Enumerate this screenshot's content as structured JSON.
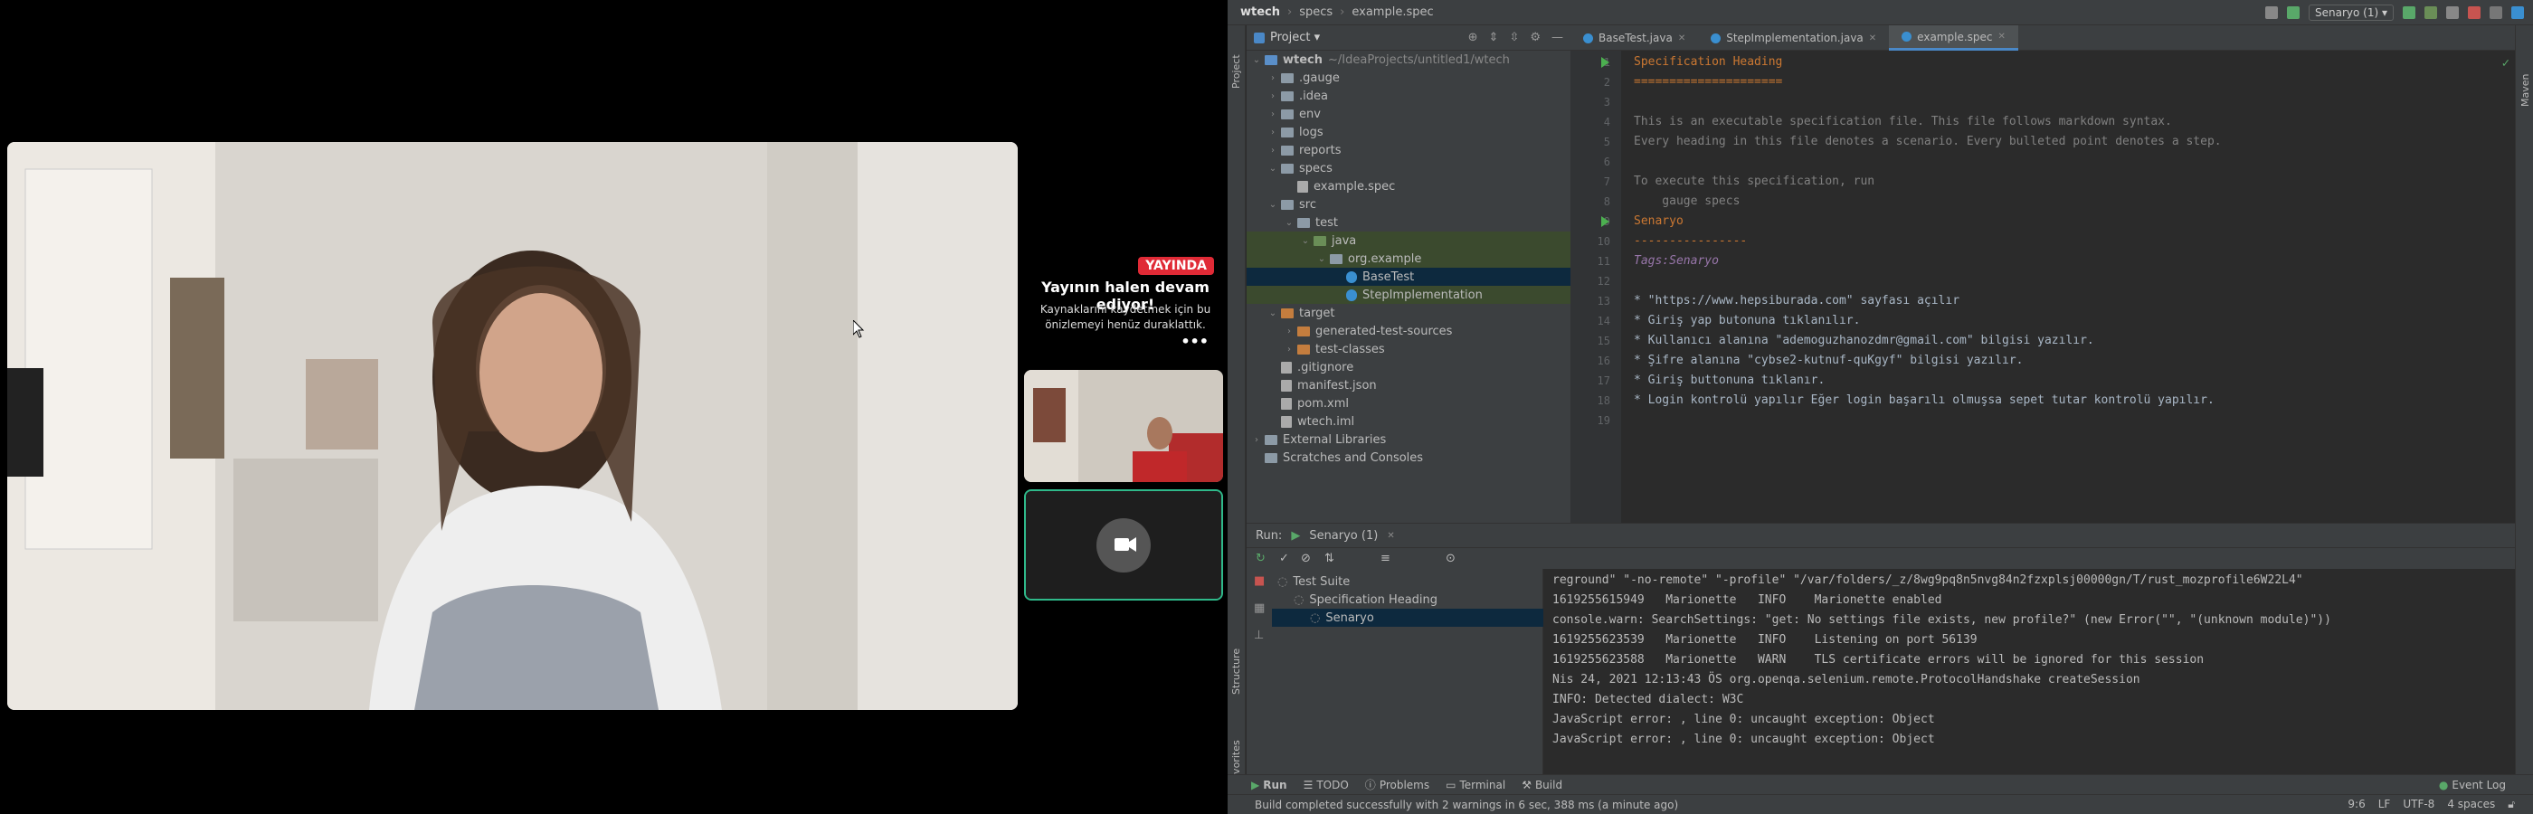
{
  "call": {
    "live_badge": "YAYINDA",
    "live_title": "Yayının halen devam ediyor!",
    "live_desc": "Kaynaklarını kaydetmek için bu önizlemeyi henüz duraklattık.",
    "more": "•••"
  },
  "ide": {
    "breadcrumb": [
      "wtech",
      "specs",
      "example.spec"
    ],
    "run_config": "Senaryo (1) ▾",
    "project_label": "Project ▾",
    "tool_strip": {
      "project": "Project",
      "structure": "Structure",
      "favorites": "Favorites",
      "maven": "Maven"
    },
    "tree": [
      {
        "name": "wtech",
        "note": "~/IdeaProjects/untitled1/wtech",
        "indent": 0,
        "twist": "v",
        "icon": "fld b",
        "bold": true
      },
      {
        "name": ".gauge",
        "indent": 1,
        "twist": ">",
        "icon": "fld"
      },
      {
        "name": ".idea",
        "indent": 1,
        "twist": ">",
        "icon": "fld"
      },
      {
        "name": "env",
        "indent": 1,
        "twist": ">",
        "icon": "fld"
      },
      {
        "name": "logs",
        "indent": 1,
        "twist": ">",
        "icon": "fld"
      },
      {
        "name": "reports",
        "indent": 1,
        "twist": ">",
        "icon": "fld"
      },
      {
        "name": "specs",
        "indent": 1,
        "twist": "v",
        "icon": "fld"
      },
      {
        "name": "example.spec",
        "indent": 2,
        "twist": "",
        "icon": "fi doc"
      },
      {
        "name": "src",
        "indent": 1,
        "twist": "v",
        "icon": "fld"
      },
      {
        "name": "test",
        "indent": 2,
        "twist": "v",
        "icon": "fld"
      },
      {
        "name": "java",
        "indent": 3,
        "twist": "v",
        "icon": "fld g",
        "hl": true
      },
      {
        "name": "org.example",
        "indent": 4,
        "twist": "v",
        "icon": "fld",
        "hl": true
      },
      {
        "name": "BaseTest",
        "indent": 5,
        "twist": "",
        "icon": "fi",
        "sel": true
      },
      {
        "name": "StepImplementation",
        "indent": 5,
        "twist": "",
        "icon": "fi",
        "hl": true
      },
      {
        "name": "target",
        "indent": 1,
        "twist": "v",
        "icon": "fld o"
      },
      {
        "name": "generated-test-sources",
        "indent": 2,
        "twist": ">",
        "icon": "fld o"
      },
      {
        "name": "test-classes",
        "indent": 2,
        "twist": ">",
        "icon": "fld o"
      },
      {
        "name": ".gitignore",
        "indent": 1,
        "twist": "",
        "icon": "fi doc"
      },
      {
        "name": "manifest.json",
        "indent": 1,
        "twist": "",
        "icon": "fi doc"
      },
      {
        "name": "pom.xml",
        "indent": 1,
        "twist": "",
        "icon": "fi doc"
      },
      {
        "name": "wtech.iml",
        "indent": 1,
        "twist": "",
        "icon": "fi doc"
      },
      {
        "name": "External Libraries",
        "indent": 0,
        "twist": ">",
        "icon": "fld"
      },
      {
        "name": "Scratches and Consoles",
        "indent": 0,
        "twist": "",
        "icon": "fld"
      }
    ],
    "tabs": [
      {
        "label": "BaseTest.java",
        "active": false
      },
      {
        "label": "StepImplementation.java",
        "active": false
      },
      {
        "label": "example.spec",
        "active": true
      }
    ],
    "code_lines": [
      {
        "n": "1",
        "t": "Specification Heading",
        "c": "hd",
        "run": true
      },
      {
        "n": "2",
        "t": "=====================",
        "c": "hd"
      },
      {
        "n": "3",
        "t": "",
        "c": ""
      },
      {
        "n": "4",
        "t": "This is an executable specification file. This file follows markdown syntax.",
        "c": "cm"
      },
      {
        "n": "5",
        "t": "Every heading in this file denotes a scenario. Every bulleted point denotes a step.",
        "c": "cm"
      },
      {
        "n": "6",
        "t": "",
        "c": ""
      },
      {
        "n": "7",
        "t": "To execute this specification, run",
        "c": "cm"
      },
      {
        "n": "8",
        "t": "    gauge specs",
        "c": "cm"
      },
      {
        "n": "9",
        "t": "Senaryo",
        "c": "hd",
        "run": true
      },
      {
        "n": "10",
        "t": "----------------",
        "c": "hd"
      },
      {
        "n": "11",
        "t": "Tags:Senaryo",
        "c": "tg"
      },
      {
        "n": "12",
        "t": "",
        "c": ""
      },
      {
        "n": "13",
        "t": "* \"https://www.hepsiburada.com\" sayfası açılır",
        "c": ""
      },
      {
        "n": "14",
        "t": "* Giriş yap butonuna tıklanılır.",
        "c": ""
      },
      {
        "n": "15",
        "t": "* Kullanıcı alanına \"ademoguzhanozdmr@gmail.com\" bilgisi yazılır.",
        "c": ""
      },
      {
        "n": "16",
        "t": "* Şifre alanına \"cybse2-kutnuf-quKgyf\" bilgisi yazılır.",
        "c": ""
      },
      {
        "n": "17",
        "t": "* Giriş buttonuna tıklanır.",
        "c": ""
      },
      {
        "n": "18",
        "t": "* Login kontrolü yapılır Eğer login başarılı olmuşsa sepet tutar kontrolü yapılır.",
        "c": ""
      },
      {
        "n": "19",
        "t": "",
        "c": ""
      }
    ],
    "run": {
      "label": "Run:",
      "tab": "Senaryo (1)",
      "tree": [
        {
          "name": "Test Suite",
          "indent": 0
        },
        {
          "name": "Specification Heading",
          "indent": 1
        },
        {
          "name": "Senaryo",
          "indent": 2,
          "sel": true
        }
      ],
      "console": [
        "reground\" \"-no-remote\" \"-profile\" \"/var/folders/_z/8wg9pq8n5nvg84n2fzxplsj00000gn/T/rust_mozprofile6W22L4\"",
        "1619255615949   Marionette   INFO    Marionette enabled",
        "console.warn: SearchSettings: \"get: No settings file exists, new profile?\" (new Error(\"\", \"(unknown module)\"))",
        "1619255623539   Marionette   INFO    Listening on port 56139",
        "1619255623588   Marionette   WARN    TLS certificate errors will be ignored for this session",
        "Nis 24, 2021 12:13:43 ÖS org.openqa.selenium.remote.ProtocolHandshake createSession",
        "INFO: Detected dialect: W3C",
        "JavaScript error: , line 0: uncaught exception: Object",
        "JavaScript error: , line 0: uncaught exception: Object"
      ]
    },
    "bottom_tabs": [
      "Run",
      "TODO",
      "Problems",
      "Terminal",
      "Build"
    ],
    "event_log": "Event Log",
    "status": "Build completed successfully with 2 warnings in 6 sec, 388 ms (a minute ago)",
    "status_right": [
      "9:6",
      "LF",
      "UTF-8",
      "4 spaces"
    ]
  }
}
